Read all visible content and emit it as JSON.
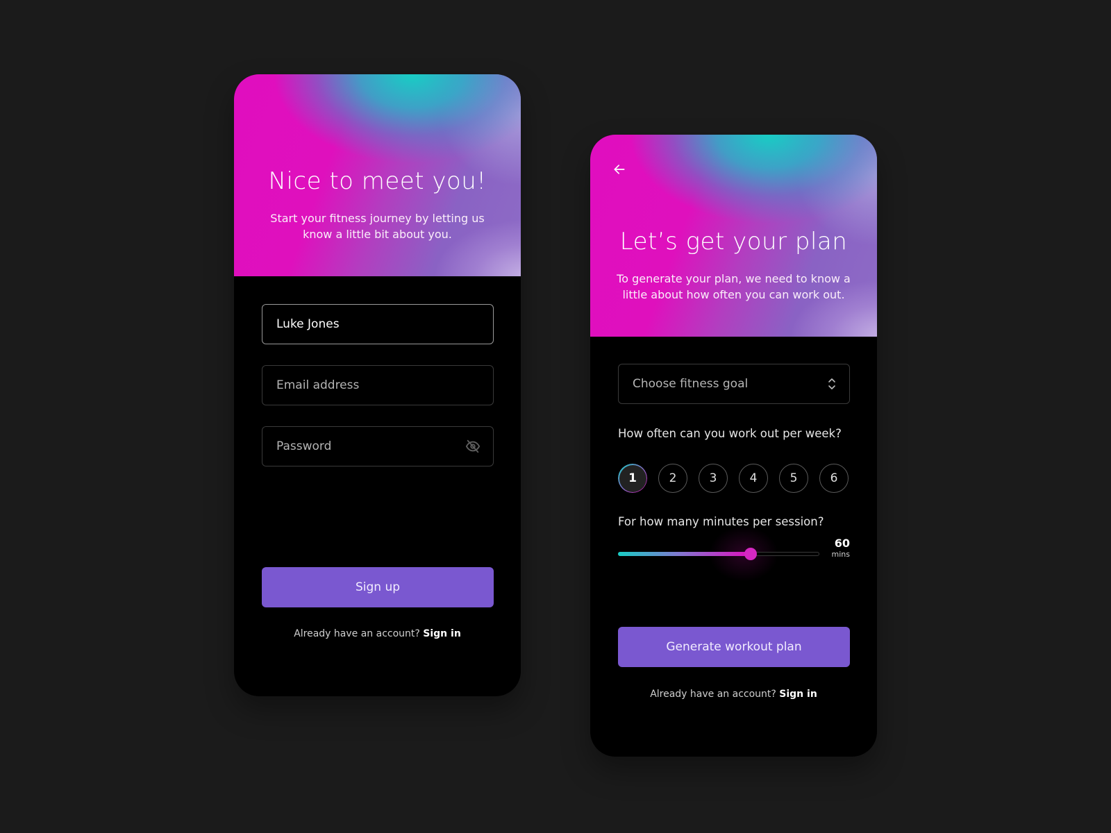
{
  "signup": {
    "title": "Nice to meet you!",
    "subtitle": "Start your fitness journey by letting us know a little bit about you.",
    "fields": {
      "name_value": "Luke Jones",
      "email_placeholder": "Email address",
      "password_placeholder": "Password"
    },
    "password_toggle_icon": "eye-off-icon",
    "submit_label": "Sign up",
    "footer_prompt": "Already have an account?",
    "footer_link": "Sign in"
  },
  "plan": {
    "back_icon": "arrow-left-icon",
    "title": "Let’s get your plan",
    "subtitle": "To generate your plan, we need to know a little about how often you can work out.",
    "goal_select": {
      "placeholder": "Choose fitness goal",
      "icon": "chevron-up-down-icon"
    },
    "frequency": {
      "question": "How often can you work out per week?",
      "options": [
        "1",
        "2",
        "3",
        "4",
        "5",
        "6"
      ],
      "selected": "1"
    },
    "minutes": {
      "question": "For how many minutes per session?",
      "value": "60",
      "unit": "mins",
      "fill_fraction": 0.66
    },
    "submit_label": "Generate workout plan",
    "footer_prompt": "Already have an account?",
    "footer_link": "Sign in"
  },
  "colors": {
    "page_background": "#1b1b1b",
    "card_background": "#000000",
    "primary_button": "#7a58d0",
    "gradient_magenta": "#e010bf",
    "gradient_teal": "#18cdc4",
    "gradient_violet": "#8a62c4"
  }
}
